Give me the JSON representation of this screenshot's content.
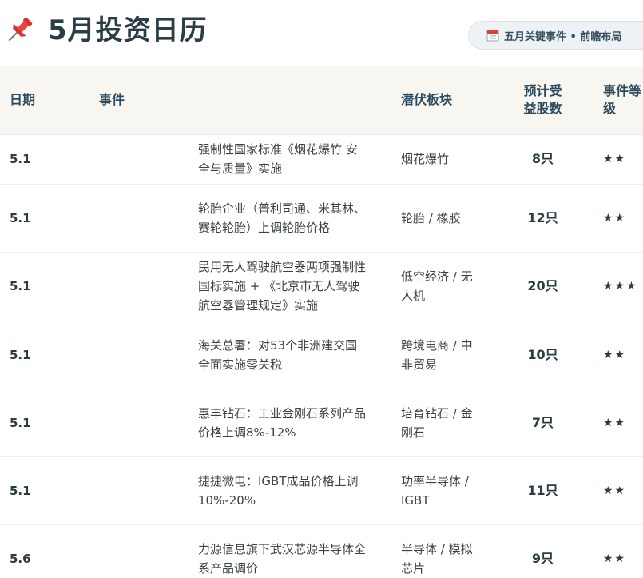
{
  "header": {
    "title": "5月投资日历",
    "badge": "五月关键事件 • 前瞻布局",
    "pin_icon": "pushpin-icon",
    "calendar_icon": "calendar-icon"
  },
  "table": {
    "columns": [
      "日期",
      "事件",
      "潜伏板块",
      "预计受益股数",
      "事件等级"
    ],
    "rows": [
      {
        "date": "5.1",
        "event": "强制性国家标准《烟花爆竹 安全与质量》实施",
        "sector": "烟花爆竹",
        "count": "8只",
        "level": "★★"
      },
      {
        "date": "5.1",
        "event": "轮胎企业（普利司通、米其林、赛轮轮胎）上调轮胎价格",
        "sector": "轮胎 / 橡胶",
        "count": "12只",
        "level": "★★"
      },
      {
        "date": "5.1",
        "event": "民用无人驾驶航空器两项强制性国标实施 + 《北京市无人驾驶航空器管理规定》实施",
        "sector": "低空经济 / 无人机",
        "count": "20只",
        "level": "★★★"
      },
      {
        "date": "5.1",
        "event": "海关总署：对53个非洲建交国全面实施零关税",
        "sector": "跨境电商 / 中非贸易",
        "count": "10只",
        "level": "★★"
      },
      {
        "date": "5.1",
        "event": "惠丰钻石：工业金刚石系列产品价格上调8%-12%",
        "sector": "培育钻石 / 金刚石",
        "count": "7只",
        "level": "★★"
      },
      {
        "date": "5.1",
        "event": "捷捷微电：IGBT成品价格上调10%-20%",
        "sector": "功率半导体 / IGBT",
        "count": "11只",
        "level": "★★"
      },
      {
        "date": "5.6",
        "event": "力源信息旗下武汉芯源半导体全系产品调价",
        "sector": "半导体 / 模拟芯片",
        "count": "9只",
        "level": "★★"
      }
    ]
  }
}
